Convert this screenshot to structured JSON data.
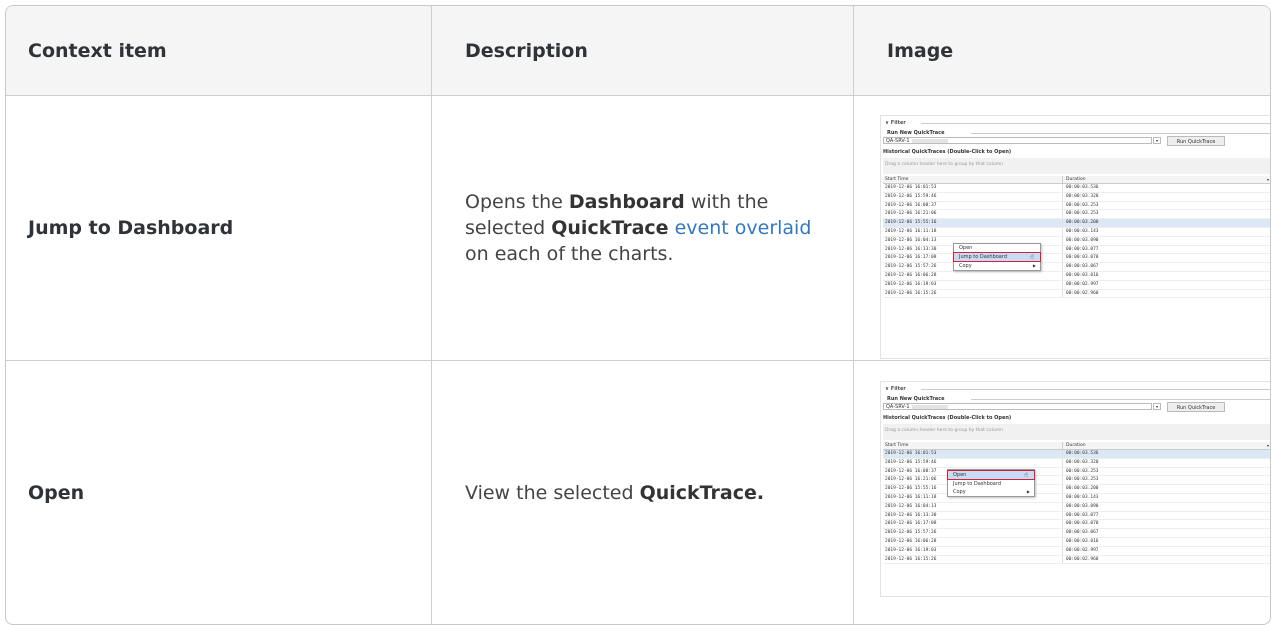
{
  "table": {
    "headers": {
      "context_item": "Context item",
      "description": "Description",
      "image": "Image"
    },
    "rows": [
      {
        "context_item": "Jump to Dashboard",
        "description": {
          "part1": "Opens the ",
          "bold1": "Dashboard",
          "part2": " with the selected ",
          "bold2": "QuickTrace",
          "link": "event overlaid",
          "part3": " on each of the charts."
        }
      },
      {
        "context_item": "Open",
        "description": {
          "part1": "View the selected ",
          "bold1": "QuickTrace."
        }
      }
    ]
  },
  "screenshot": {
    "filter_label": "∨  Filter",
    "run_new_label": "Run New QuickTrace",
    "server_value": "QA-SRV-1",
    "run_button": "Run QuickTrace",
    "historical_label": "Historical QuickTraces (Double-Click to Open)",
    "group_hint": "Drag a column header here to group by that column",
    "col_start": "Start Time",
    "col_duration": "Duration",
    "rows": [
      {
        "start": "2019-12-06 16:01:53",
        "duration": "00:00:03.536"
      },
      {
        "start": "2019-12-06 15:59:46",
        "duration": "00:00:03.320"
      },
      {
        "start": "2019-12-06 16:08:37",
        "duration": "00:00:03.253"
      },
      {
        "start": "2019-12-06 16:21:06",
        "duration": "00:00:03.253"
      },
      {
        "start": "2019-12-06 15:55:16",
        "duration": "00:00:03.200"
      },
      {
        "start": "2019-12-06 16:11:18",
        "duration": "00:00:03.143"
      },
      {
        "start": "2019-12-06 16:04:13",
        "duration": "00:00:03.090"
      },
      {
        "start": "2019-12-06 16:13:30",
        "duration": "00:00:03.077"
      },
      {
        "start": "2019-12-06 16:17:08",
        "duration": "00:00:03.070"
      },
      {
        "start": "2019-12-06 15:57:26",
        "duration": "00:00:03.067"
      },
      {
        "start": "2019-12-06 16:06:28",
        "duration": "00:00:03.016"
      },
      {
        "start": "2019-12-06 16:19:03",
        "duration": "00:00:02.997"
      },
      {
        "start": "2019-12-06 16:15:26",
        "duration": "00:00:02.960"
      }
    ],
    "menu": {
      "open": "Open",
      "jump": "Jump to Dashboard",
      "copy": "Copy"
    }
  }
}
